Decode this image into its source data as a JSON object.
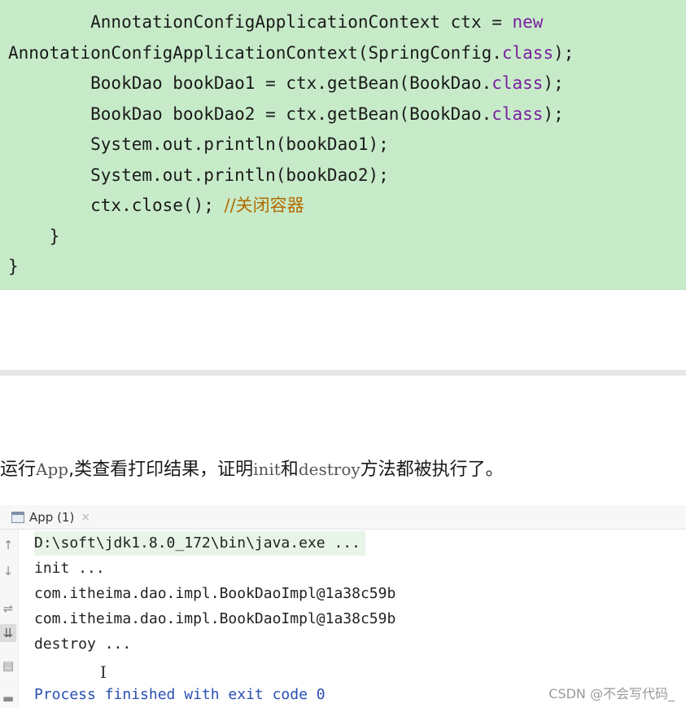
{
  "code": {
    "line1_a": "        AnnotationConfigApplicationContext ctx = ",
    "line1_kw": "new",
    "line2_a": "AnnotationConfigApplicationContext(SpringConfig.",
    "line2_kw": "class",
    "line2_b": ");",
    "line3_a": "        BookDao bookDao1 = ctx.getBean(BookDao.",
    "line3_kw": "class",
    "line3_b": ");",
    "line4_a": "        BookDao bookDao2 = ctx.getBean(BookDao.",
    "line4_kw": "class",
    "line4_b": ");",
    "line5": "        System.out.println(bookDao1);",
    "line6": "        System.out.println(bookDao2);",
    "line7_a": "        ctx.close(); ",
    "line7_cmt": "//关闭容器",
    "line8": "    }",
    "line9": "}"
  },
  "paragraph": {
    "p1": "运行",
    "p2": "App",
    "p3": ",类查看打印结果，证明",
    "p4": "init",
    "p5": "和",
    "p6": "destroy",
    "p7": "方法都被执行了。"
  },
  "console": {
    "tab_label": "App (1)",
    "tab_close": "×",
    "lines": [
      "D:\\soft\\jdk1.8.0_172\\bin\\java.exe ...",
      "init ...",
      "com.itheima.dao.impl.BookDaoImpl@1a38c59b",
      "com.itheima.dao.impl.BookDaoImpl@1a38c59b",
      "destroy ...",
      "Process finished with exit code 0"
    ]
  },
  "icons": {
    "up": "↑",
    "down": "↓",
    "wrap": "⇌",
    "scroll": "⇊",
    "print": "▤",
    "trash": "▬"
  },
  "watermark": "CSDN @不会写代码_"
}
